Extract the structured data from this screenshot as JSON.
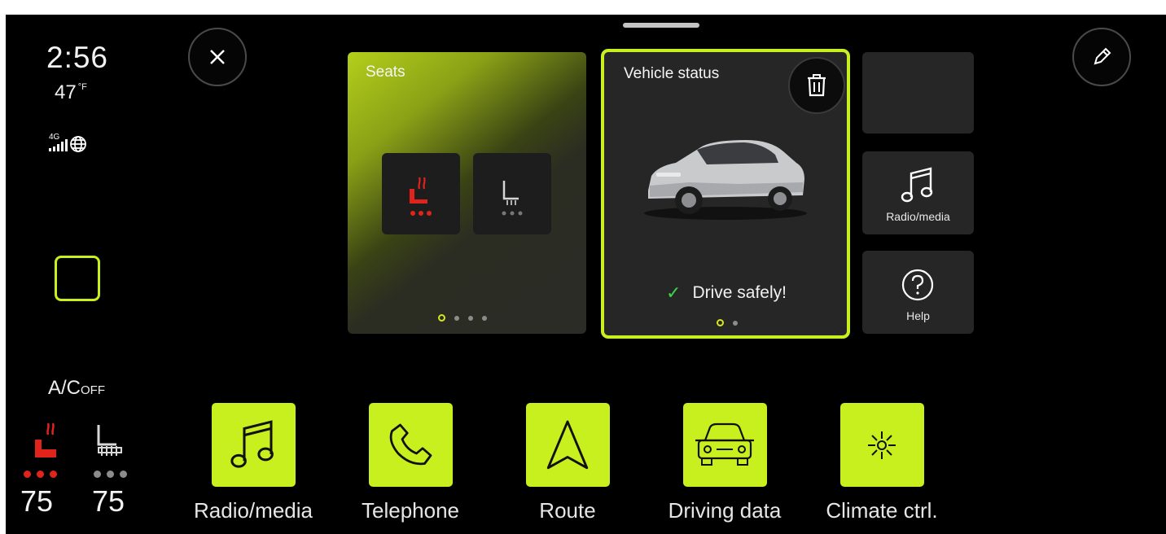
{
  "status": {
    "time": "2:56",
    "outside_temp": "47",
    "temp_unit": "°F",
    "network": "4G",
    "icons": [
      "signal-bars-icon",
      "globe-icon"
    ]
  },
  "climate": {
    "ac_label": "A/C",
    "ac_state": "OFF",
    "driver_temp": "75",
    "passenger_temp": "75",
    "driver_seat_heat_level": 3,
    "passenger_seat_heat_level": 0
  },
  "widgets": {
    "seats": {
      "title": "Seats",
      "page_count": 4,
      "active_page": 0
    },
    "vehicle_status": {
      "title": "Vehicle status",
      "message": "Drive safely!",
      "page_count": 2,
      "active_page": 0
    },
    "radio_media": {
      "label": "Radio/media",
      "icon": "music-note-icon"
    },
    "help": {
      "label": "Help",
      "icon": "question-circle-icon"
    }
  },
  "dock": [
    {
      "label": "Radio/media",
      "icon": "music-note-icon"
    },
    {
      "label": "Telephone",
      "icon": "phone-icon"
    },
    {
      "label": "Route",
      "icon": "navigation-arrow-icon"
    },
    {
      "label": "Driving data",
      "icon": "car-front-icon"
    },
    {
      "label": "Climate ctrl.",
      "icon": "fan-icon"
    }
  ],
  "colors": {
    "accent": "#c8ef1e",
    "heat_active": "#e0241c",
    "heat_inactive": "#8c8c8c",
    "check": "#39d64b",
    "background": "#000000",
    "card": "#262626"
  }
}
